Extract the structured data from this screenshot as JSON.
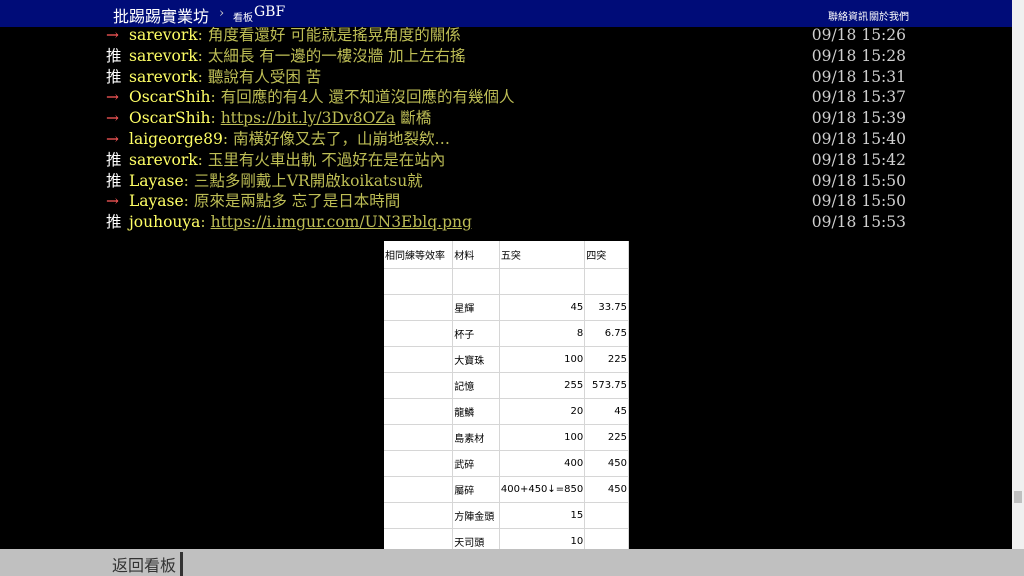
{
  "header": {
    "site_title": "批踢踢實業坊",
    "separator": "›",
    "board_label": "看板",
    "board_name": "GBF",
    "link_contact": "聯絡資訊",
    "link_about": "關於我們"
  },
  "pushes": [
    {
      "tag": "→",
      "type": "arrow",
      "user": "sarevork",
      "content": "角度看還好 可能就是搖晃角度的關係",
      "time": "09/18 15:26"
    },
    {
      "tag": "推",
      "type": "push",
      "user": "sarevork",
      "content": "太細長 有一邊的一樓沒牆 加上左右搖",
      "time": "09/18 15:28"
    },
    {
      "tag": "推",
      "type": "push",
      "user": "sarevork",
      "content": "聽說有人受困 苦",
      "time": "09/18 15:31"
    },
    {
      "tag": "→",
      "type": "arrow",
      "user": "OscarShih",
      "content": "有回應的有4人 還不知道沒回應的有幾個人",
      "time": "09/18 15:37"
    },
    {
      "tag": "→",
      "type": "arrow",
      "user": "OscarShih",
      "content": "https://bit.ly/3Dv8OZa",
      "content_suffix": " 斷橋",
      "is_link": true,
      "time": "09/18 15:39"
    },
    {
      "tag": "→",
      "type": "arrow",
      "user": "laigeorge89",
      "content": "南橫好像又去了，山崩地裂欸…",
      "time": "09/18 15:40"
    },
    {
      "tag": "推",
      "type": "push",
      "user": "sarevork",
      "content": "玉里有火車出軌 不過好在是在站內",
      "time": "09/18 15:42"
    },
    {
      "tag": "推",
      "type": "push",
      "user": "Layase",
      "content": "三點多剛戴上VR開啟koikatsu就",
      "time": "09/18 15:50"
    },
    {
      "tag": "→",
      "type": "arrow",
      "user": "Layase",
      "content": "原來是兩點多 忘了是日本時間",
      "time": "09/18 15:50"
    },
    {
      "tag": "推",
      "type": "push",
      "user": "jouhouya",
      "content": "https://i.imgur.com/UN3Eblq.png",
      "is_link": true,
      "time": "09/18 15:53"
    }
  ],
  "table": {
    "headers": [
      "相同練等效率",
      "材料",
      "五突",
      "四突"
    ],
    "rows": [
      [
        "",
        "",
        "",
        ""
      ],
      [
        "",
        "星輝",
        "45",
        "33.75"
      ],
      [
        "",
        "杯子",
        "8",
        "6.75"
      ],
      [
        "",
        "大寶珠",
        "100",
        "225"
      ],
      [
        "",
        "記憶",
        "255",
        "573.75"
      ],
      [
        "",
        "龍鱗",
        "20",
        "45"
      ],
      [
        "",
        "島素材",
        "100",
        "225"
      ],
      [
        "",
        "武碎",
        "400",
        "450"
      ],
      [
        "",
        "屬碎",
        "400+450↓=850",
        "450"
      ],
      [
        "",
        "方陣金頭",
        "15",
        ""
      ],
      [
        "",
        "天司頭",
        "10",
        ""
      ]
    ]
  },
  "footer": {
    "back_label": "返回看板"
  },
  "colors": {
    "header_bg": "#000c78",
    "push_tag": "#ffffff",
    "arrow_tag": "#ff5a5a",
    "user_id": "#ffff66",
    "content": "#bdbd55",
    "footer_bg": "#c0c0c0"
  }
}
